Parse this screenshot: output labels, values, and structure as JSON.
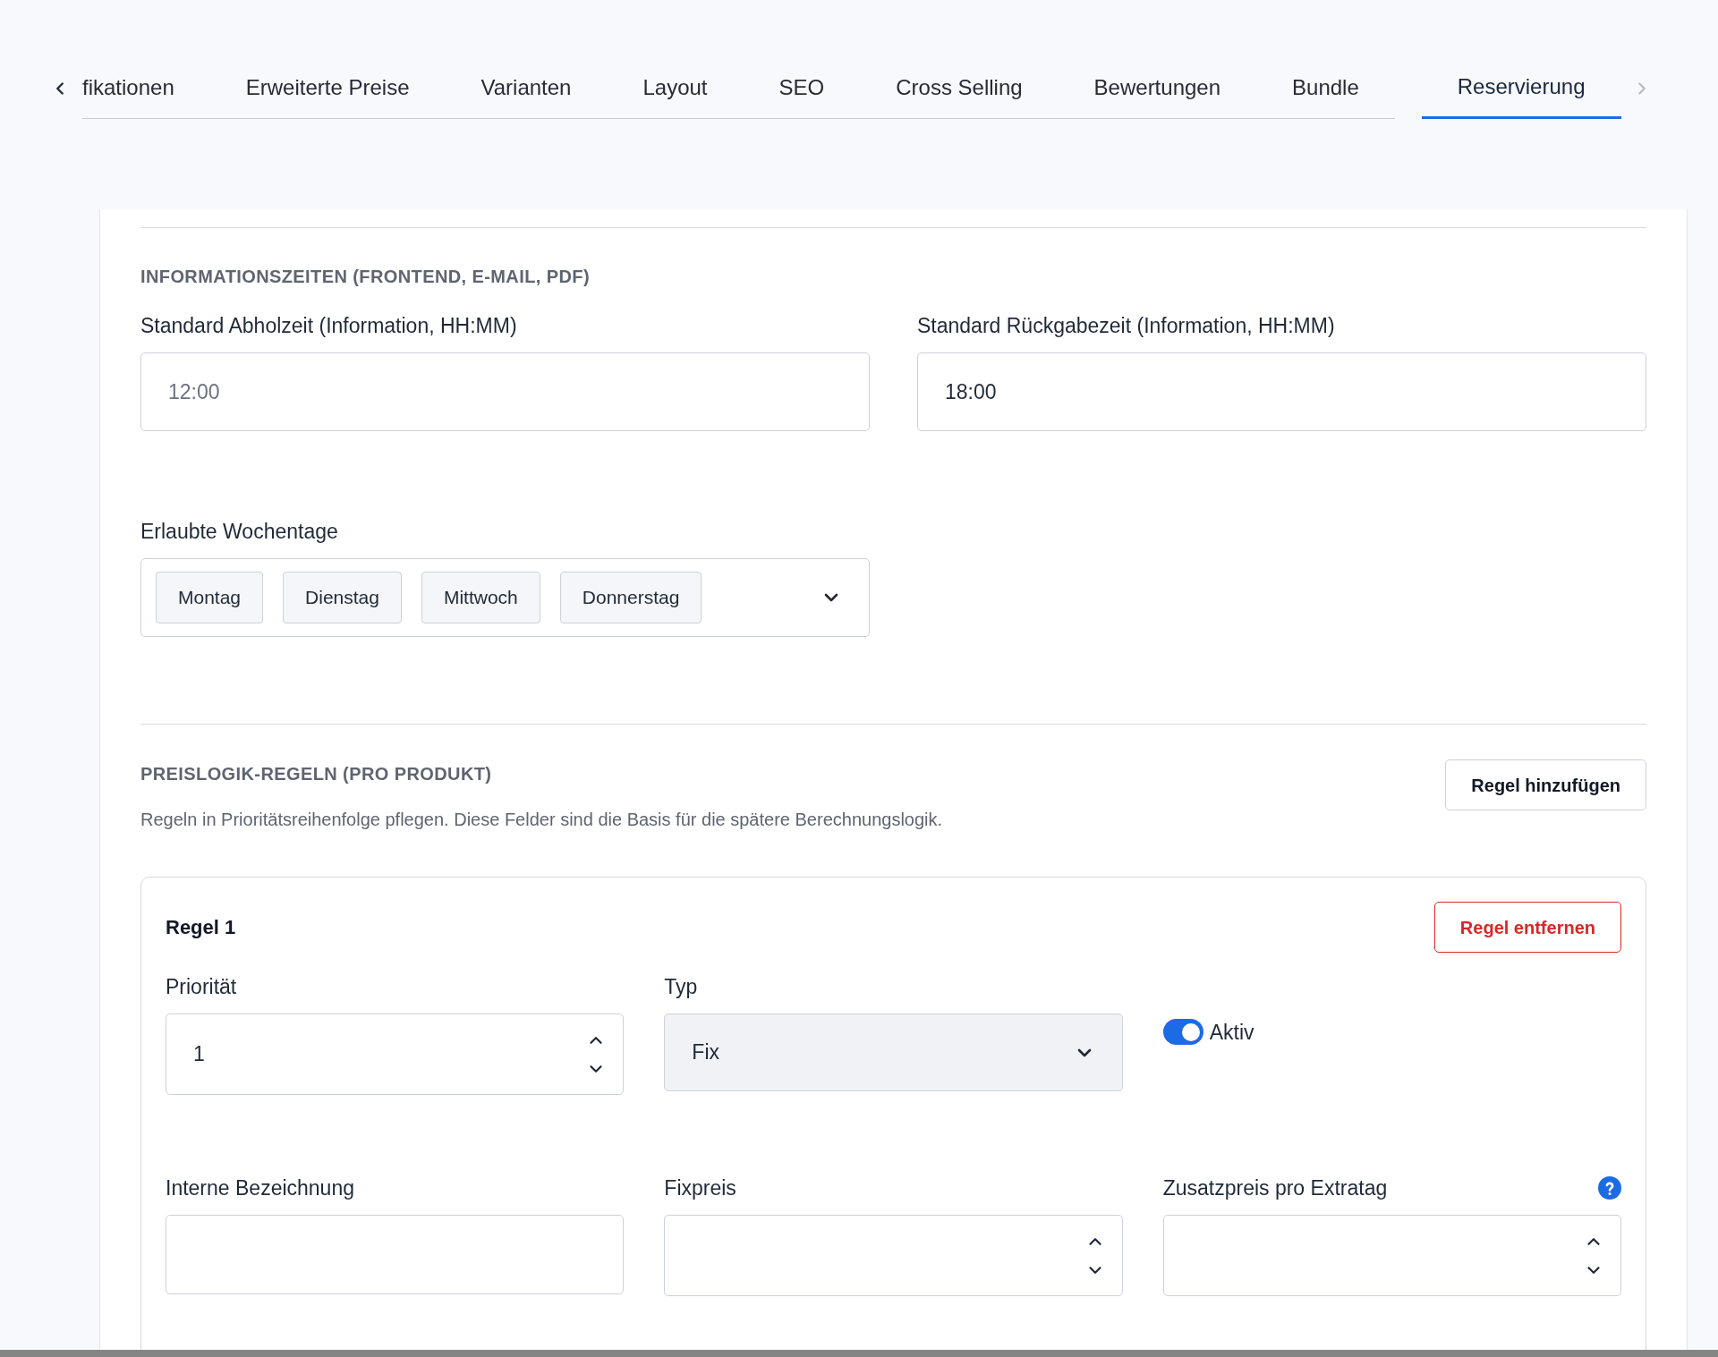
{
  "tab_bar": {
    "left_arrow": {
      "disabled": false
    },
    "right_arrow": {
      "disabled": true
    },
    "tabs": [
      {
        "label": "fikationen",
        "selected": false
      },
      {
        "label": "Erweiterte Preise",
        "selected": false
      },
      {
        "label": "Varianten",
        "selected": false
      },
      {
        "label": "Layout",
        "selected": false
      },
      {
        "label": "SEO",
        "selected": false
      },
      {
        "label": "Cross Selling",
        "selected": false
      },
      {
        "label": "Bewertungen",
        "selected": false
      },
      {
        "label": "Bundle",
        "selected": false
      },
      {
        "label": "Reservierung",
        "selected": true
      }
    ]
  },
  "info_times": {
    "heading": "INFORMATIONSZEITEN (FRONTEND, E-MAIL, PDF)",
    "fields": [
      {
        "label": "Standard Abholzeit (Information, HH:MM)",
        "placeholder": "12:00"
      },
      {
        "label": "Standard Rückgabezeit (Information, HH:MM)",
        "value": "18:00"
      }
    ]
  },
  "weekdays": {
    "label": "Erlaubte Wochentage",
    "chips": [
      "Montag",
      "Dienstag",
      "Mittwoch",
      "Donnerstag"
    ]
  },
  "price_rules": {
    "heading": "PREISLOGIK-REGELN (PRO PRODUKT)",
    "add_button": "Regel hinzufügen",
    "description": "Regeln in Prioritätsreihenfolge pflegen. Diese Felder sind die Basis für die spätere Berechnungslogik.",
    "rules": [
      {
        "title": "Regel 1",
        "remove_button": "Regel entfernen",
        "fields": [
          {
            "kind": "number",
            "label": "Priorität",
            "value": "1"
          },
          {
            "kind": "select",
            "label": "Typ",
            "value": "Fix"
          },
          {
            "kind": "toggle",
            "label": "Aktiv",
            "on": true
          },
          {
            "kind": "text",
            "label": "Interne Bezeichnung"
          },
          {
            "kind": "number",
            "label": "Fixpreis"
          },
          {
            "kind": "number",
            "label": "Zusatzpreis pro Extratag",
            "help": true
          }
        ]
      }
    ]
  }
}
